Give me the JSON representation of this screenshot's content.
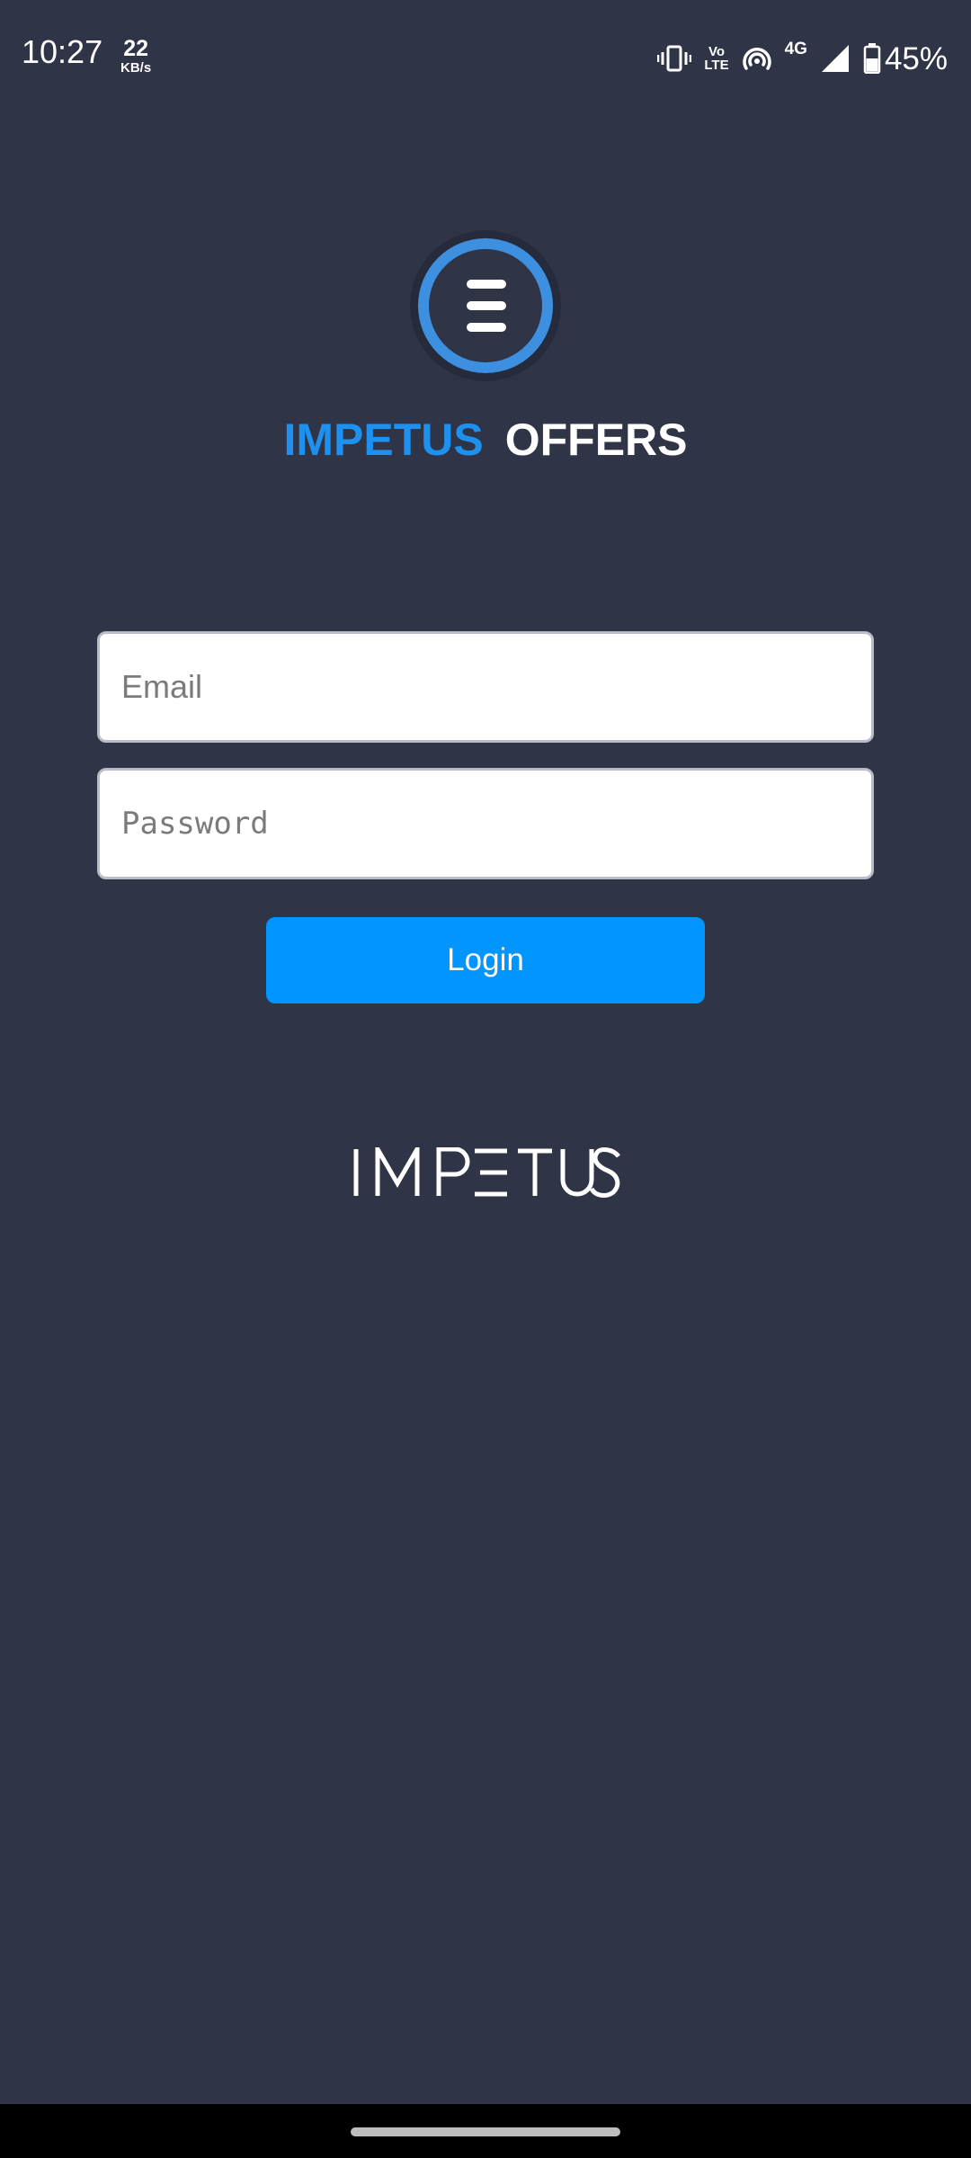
{
  "status_bar": {
    "time": "10:27",
    "net_speed_value": "22",
    "net_speed_unit": "KB/s",
    "volte_top": "Vo",
    "volte_bottom": "LTE",
    "network_type": "4G",
    "battery_percent": "45%",
    "icons": [
      "vibrate-icon",
      "volte-icon",
      "hotspot-icon",
      "signal-icon",
      "battery-icon"
    ]
  },
  "header": {
    "title_part1": "IMPETUS",
    "title_part2": "OFFERS",
    "logo_icon": "menu-lines-icon"
  },
  "login_form": {
    "email_placeholder": "Email",
    "email_value": "",
    "password_placeholder": "Password",
    "password_value": "",
    "login_label": "Login"
  },
  "footer": {
    "brand_logo": "IMPETUS"
  },
  "colors": {
    "background": "#2f3447",
    "accent_blue": "#0095ff",
    "title_blue": "#1e90ee",
    "logo_ring": "#3d8fe0",
    "nav_bar": "#000000"
  }
}
